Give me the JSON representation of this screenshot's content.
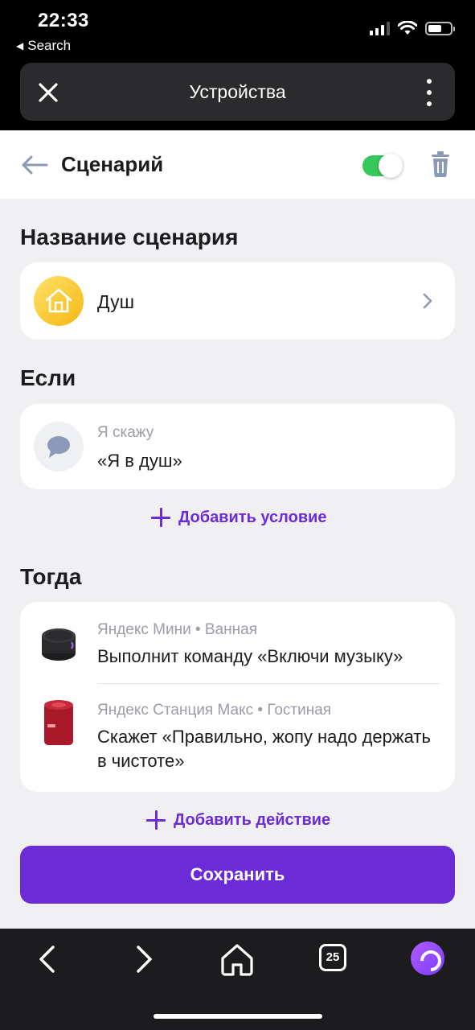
{
  "status_bar": {
    "time": "22:33",
    "back_app": "Search"
  },
  "browser": {
    "title": "Устройства",
    "tabs_count": "25"
  },
  "header": {
    "title": "Сценарий",
    "enabled": true
  },
  "name_section": {
    "heading": "Название сценария",
    "scenario_name": "Душ"
  },
  "if_section": {
    "heading": "Если",
    "condition_label": "Я скажу",
    "condition_text": "«Я в душ»",
    "add_label": "Добавить условие"
  },
  "then_section": {
    "heading": "Тогда",
    "actions": [
      {
        "device": "Яндекс Мини • Ванная",
        "text": "Выполнит команду «Включи музыку»"
      },
      {
        "device": "Яндекс Станция Макс • Гостиная",
        "text": "Скажет «Правильно, жопу надо держать в чистоте»"
      }
    ],
    "add_label": "Добавить действие"
  },
  "save_label": "Сохранить",
  "colors": {
    "accent": "#6b2bd6",
    "toggle_on": "#37c85a",
    "house_icon_bg": "#f3b812"
  }
}
